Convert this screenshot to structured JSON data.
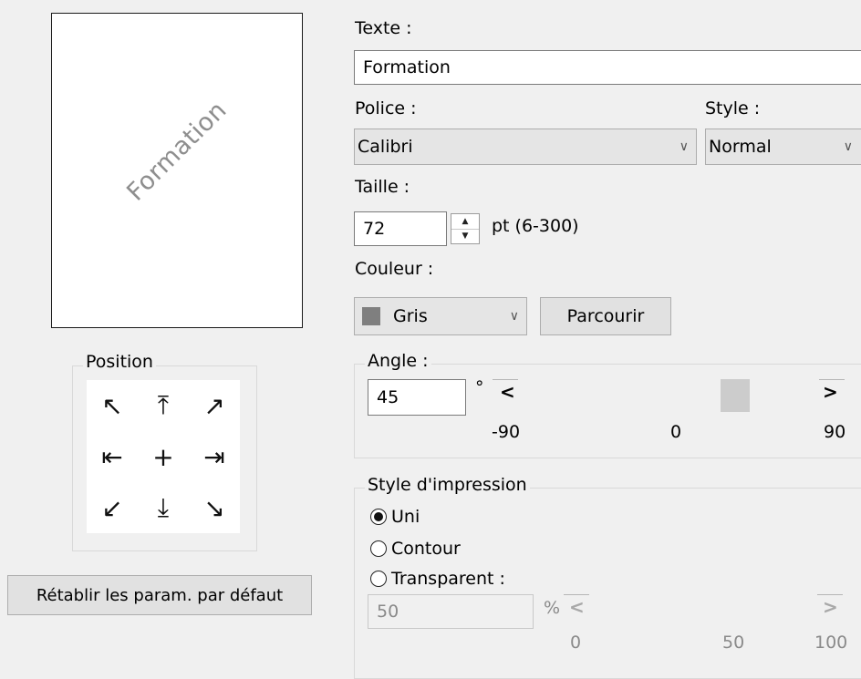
{
  "preview": {
    "watermark_text": "Formation",
    "watermark_color": "#8e8e8e"
  },
  "position": {
    "legend": "Position",
    "buttons": [
      {
        "name": "top-left",
        "glyph": "↖"
      },
      {
        "name": "top-center",
        "glyph": "⤒"
      },
      {
        "name": "top-right",
        "glyph": "↗"
      },
      {
        "name": "middle-left",
        "glyph": "⇤"
      },
      {
        "name": "center",
        "glyph": "+"
      },
      {
        "name": "middle-right",
        "glyph": "⇥"
      },
      {
        "name": "bottom-left",
        "glyph": "↙"
      },
      {
        "name": "bottom-center",
        "glyph": "⤓"
      },
      {
        "name": "bottom-right",
        "glyph": "↘"
      }
    ]
  },
  "reset_button_label": "Rétablir les param. par défaut",
  "text": {
    "label": "Texte :",
    "value": "Formation"
  },
  "font": {
    "label": "Police :",
    "value": "Calibri"
  },
  "style": {
    "label": "Style :",
    "value": "Normal"
  },
  "size": {
    "label": "Taille :",
    "value": "72",
    "unit": "pt (6-300)"
  },
  "color": {
    "label": "Couleur :",
    "value": "Gris",
    "swatch": "#7f7f7f",
    "browse_label": "Parcourir"
  },
  "angle": {
    "legend": "Angle :",
    "value": "45",
    "degree_symbol": "°",
    "left_arrow": "<",
    "right_arrow": ">",
    "ticks": [
      "-90",
      "0",
      "90"
    ],
    "slider_value": 45
  },
  "print_style": {
    "legend": "Style d'impression",
    "options": [
      {
        "label": "Uni",
        "selected": true
      },
      {
        "label": "Contour",
        "selected": false
      },
      {
        "label": "Transparent :",
        "selected": false
      }
    ],
    "transparency_value": "50",
    "percent_symbol": "%",
    "left_arrow": "<",
    "right_arrow": ">",
    "ticks": [
      "0",
      "50",
      "100"
    ]
  },
  "icons": {
    "chevron": "chevron-down-icon",
    "spin_up": "triangle-up-icon",
    "spin_down": "triangle-down-icon"
  }
}
